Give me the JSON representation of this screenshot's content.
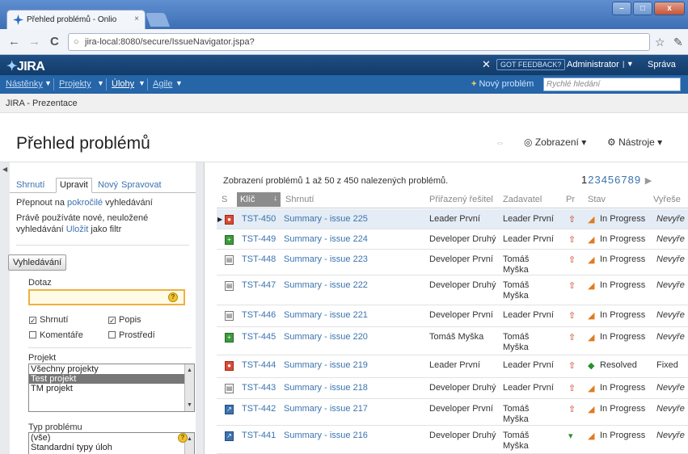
{
  "browser": {
    "tab_title": "Přehled problémů - Onlio",
    "tab_close": "×",
    "window_buttons": {
      "minimize": "–",
      "maximize": "□",
      "close": "x"
    },
    "back": "←",
    "forward": "→",
    "reload": "C",
    "url": "jira-local:8080/secure/IssueNavigator.jspa?"
  },
  "header": {
    "logo": "JIRA",
    "feedback": "GOT FEEDBACK?",
    "user": "Administrator",
    "admin_link": "Správa"
  },
  "nav": {
    "items": [
      {
        "label": "Nástěnky"
      },
      {
        "label": "Projekty"
      },
      {
        "label": "Úlohy"
      },
      {
        "label": "Agile"
      }
    ],
    "new_issue": "Nový problém",
    "quick_search_placeholder": "Rychlé hledání"
  },
  "breadcrumb": "JIRA - Prezentace",
  "page": {
    "title": "Přehled problémů",
    "view_menu": "Zobrazení",
    "tools_menu": "Nástroje"
  },
  "left_panel": {
    "tabs": [
      "Shrnutí",
      "Upravit",
      "Nový",
      "Spravovat"
    ],
    "switch_text_prefix": "Přepnout na ",
    "switch_link": "pokročilé",
    "switch_text_suffix": " vyhledávání",
    "unsaved_text_1": "Právě používáte nové, neuložené",
    "unsaved_text_2_prefix": "vyhledávání ",
    "unsaved_save_link": "Uložit",
    "unsaved_text_2_suffix": " jako filtr",
    "search_button": "Vyhledávání",
    "query_label": "Dotaz",
    "query_value": "",
    "checkboxes": [
      {
        "label": "Shrnutí",
        "checked": true
      },
      {
        "label": "Popis",
        "checked": true
      },
      {
        "label": "Komentáře",
        "checked": false
      },
      {
        "label": "Prostředí",
        "checked": false
      }
    ],
    "project_label": "Projekt",
    "project_options": [
      {
        "label": "Všechny projekty",
        "selected": false
      },
      {
        "label": "Test projekt",
        "selected": true
      },
      {
        "label": "TM projekt",
        "selected": false
      }
    ],
    "issue_type_label": "Typ problému",
    "issue_type_options": [
      "(vše)",
      "Standardní typy úloh"
    ]
  },
  "results": {
    "summary": "Zobrazení problémů 1 až 50 z 450 nalezených problémů.",
    "current_page": "1",
    "other_pages": "23456789",
    "next": "▶",
    "columns": [
      "S",
      "Klíč",
      "Shrnutí",
      "Přiřazený řešitel",
      "Zadavatel",
      "Pr",
      "Stav",
      "Vyřeše"
    ],
    "rows": [
      {
        "type": "bug",
        "key": "TST-450",
        "summary": "Summary - issue 225",
        "assignee": "Leader První",
        "reporter": "Leader První",
        "reporter2": "",
        "priority": "major",
        "status": "In Progress",
        "resolution": "Nevyře"
      },
      {
        "type": "feature",
        "key": "TST-449",
        "summary": "Summary - issue 224",
        "assignee": "Developer Druhý",
        "reporter": "Leader První",
        "reporter2": "",
        "priority": "major",
        "status": "In Progress",
        "resolution": "Nevyře"
      },
      {
        "type": "task",
        "key": "TST-448",
        "summary": "Summary - issue 223",
        "assignee": "Developer První",
        "reporter": "Tomáš",
        "reporter2": "Myška",
        "priority": "major",
        "status": "In Progress",
        "resolution": "Nevyře"
      },
      {
        "type": "task",
        "key": "TST-447",
        "summary": "Summary - issue 222",
        "assignee": "Developer Druhý",
        "reporter": "Tomáš",
        "reporter2": "Myška",
        "priority": "major",
        "status": "In Progress",
        "resolution": "Nevyře"
      },
      {
        "type": "task",
        "key": "TST-446",
        "summary": "Summary - issue 221",
        "assignee": "Developer První",
        "reporter": "Leader První",
        "reporter2": "",
        "priority": "major",
        "status": "In Progress",
        "resolution": "Nevyře"
      },
      {
        "type": "feature",
        "key": "TST-445",
        "summary": "Summary - issue 220",
        "assignee": "Tomáš Myška",
        "reporter": "Tomáš",
        "reporter2": "Myška",
        "priority": "major",
        "status": "In Progress",
        "resolution": "Nevyře"
      },
      {
        "type": "bug",
        "key": "TST-444",
        "summary": "Summary - issue 219",
        "assignee": "Leader První",
        "reporter": "Leader První",
        "reporter2": "",
        "priority": "major",
        "status": "Resolved",
        "resolution": "Fixed"
      },
      {
        "type": "task",
        "key": "TST-443",
        "summary": "Summary - issue 218",
        "assignee": "Developer Druhý",
        "reporter": "Leader První",
        "reporter2": "",
        "priority": "major",
        "status": "In Progress",
        "resolution": "Nevyře"
      },
      {
        "type": "improvement",
        "key": "TST-442",
        "summary": "Summary - issue 217",
        "assignee": "Developer První",
        "reporter": "Tomáš",
        "reporter2": "Myška",
        "priority": "major",
        "status": "In Progress",
        "resolution": "Nevyře"
      },
      {
        "type": "improvement",
        "key": "TST-441",
        "summary": "Summary - issue 216",
        "assignee": "Developer Druhý",
        "reporter": "Tomáš",
        "reporter2": "Myška",
        "priority": "minor",
        "status": "In Progress",
        "resolution": "Nevyře"
      }
    ]
  },
  "colors": {
    "header_bg": "#1a4679",
    "nav_bg": "#2565a8",
    "link": "#3b73af",
    "priority_major": "#c43a1c",
    "priority_minor": "#2a8f2a"
  }
}
